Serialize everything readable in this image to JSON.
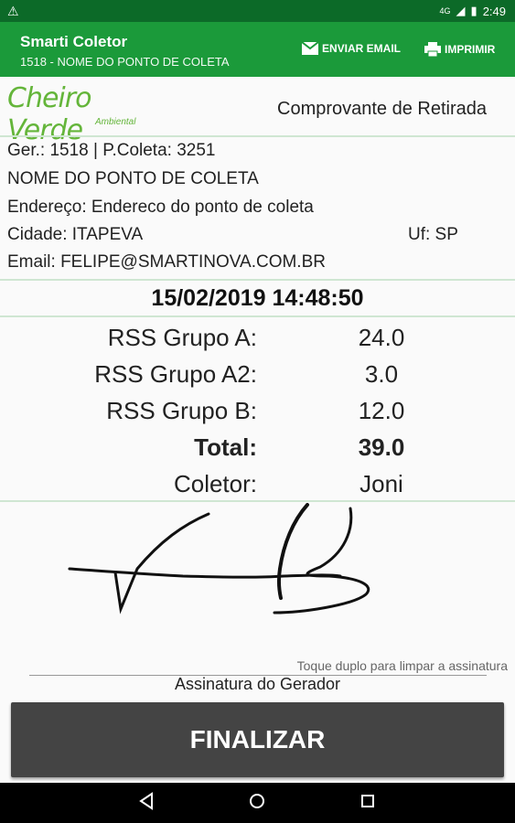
{
  "status_bar": {
    "network": "4G",
    "time": "2:49"
  },
  "app_bar": {
    "title": "Smarti Coletor",
    "subtitle": "1518 - NOME DO PONTO DE COLETA",
    "email_label": "ENVIAR EMAIL",
    "print_label": "IMPRIMIR"
  },
  "logo": {
    "brand": "Cheiro Verde",
    "tagline": "Ambiental"
  },
  "receipt": {
    "title": "Comprovante de Retirada",
    "generator_line": "Ger.: 1518 | P.Coleta: 3251",
    "point_name": "NOME DO PONTO DE COLETA",
    "address": "Endereço: Endereco do ponto de coleta",
    "city": "Cidade: ITAPEVA",
    "uf": "Uf: SP",
    "email": "Email: FELIPE@SMARTINOVA.COM.BR",
    "datetime": "15/02/2019 14:48:50",
    "rows": [
      {
        "label": "RSS Grupo A:",
        "value": "24.0"
      },
      {
        "label": "RSS Grupo A2:",
        "value": "3.0"
      },
      {
        "label": "RSS Grupo B:",
        "value": "12.0"
      },
      {
        "label": "Total:",
        "value": "39.0"
      },
      {
        "label": "Coletor:",
        "value": "Joni"
      }
    ]
  },
  "signature": {
    "hint": "Toque duplo para limpar a assinatura",
    "label": "Assinatura do Gerador"
  },
  "finalize_label": "FINALIZAR",
  "colors": {
    "status_bar": "#0c6a28",
    "app_bar": "#1b9a3a",
    "brand_green": "#64b53a",
    "button": "#444444"
  }
}
